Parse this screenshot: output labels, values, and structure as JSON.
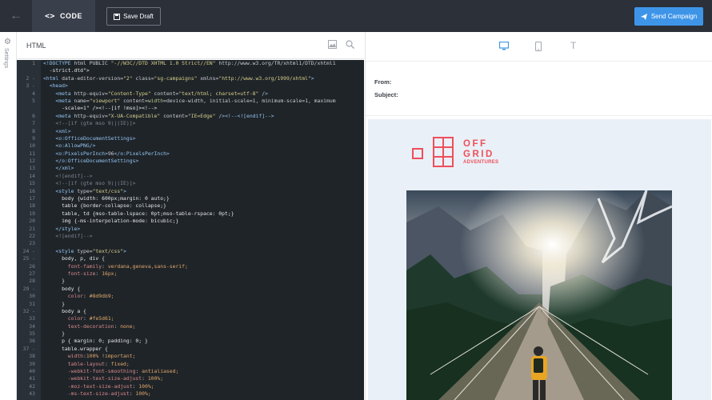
{
  "toolbar": {
    "back_icon": "arrow-left-icon",
    "code_tab_label": "CODE",
    "save_draft_label": "Save Draft",
    "send_campaign_label": "Send Campaign"
  },
  "rail": {
    "label": "Settings"
  },
  "editor": {
    "title": "HTML",
    "lines": [
      {
        "n": "1",
        "t": "<!DOCTYPE html PUBLIC \"-//W3C//DTD XHTML 1.0 Strict//EN\" \"http://www.w3.org/TR/xhtml1/DTD/xhtml1"
      },
      {
        "n": "",
        "t": "  -strict.dtd\">"
      },
      {
        "n": "2 -",
        "t": "<html data-editor-version=\"2\" class=\"sg-campaigns\" xmlns=\"http://www.w3.org/1999/xhtml\">"
      },
      {
        "n": "3 -",
        "t": "  <head>"
      },
      {
        "n": "4",
        "t": "    <meta http-equiv=\"Content-Type\" content=\"text/html; charset=utf-8\" />"
      },
      {
        "n": "5",
        "t": "    <meta name=\"viewport\" content=\"width=device-width, initial-scale=1, minimum-scale=1, maximum"
      },
      {
        "n": "",
        "t": "      -scale=1\" /><!--[if !mso]><!-->"
      },
      {
        "n": "6",
        "t": "    <meta http-equiv=\"X-UA-Compatible\" content=\"IE=Edge\" /><!--<![endif]-->"
      },
      {
        "n": "7",
        "t": "    <!--[if (gte mso 9)|(IE)]>"
      },
      {
        "n": "8",
        "t": "    <xml>"
      },
      {
        "n": "9",
        "t": "    <o:OfficeDocumentSettings>"
      },
      {
        "n": "10",
        "t": "    <o:AllowPNG/>"
      },
      {
        "n": "11",
        "t": "    <o:PixelsPerInch>96</o:PixelsPerInch>"
      },
      {
        "n": "12",
        "t": "    </o:OfficeDocumentSettings>"
      },
      {
        "n": "13",
        "t": "    </xml>"
      },
      {
        "n": "14",
        "t": "    <![endif]-->"
      },
      {
        "n": "15",
        "t": "    <!--[if (gte mso 9)|(IE)]>"
      },
      {
        "n": "16",
        "t": "    <style type=\"text/css\">"
      },
      {
        "n": "17",
        "t": "      body {width: 600px;margin: 0 auto;}"
      },
      {
        "n": "18",
        "t": "      table {border-collapse: collapse;}"
      },
      {
        "n": "19",
        "t": "      table, td {mso-table-lspace: 0pt;mso-table-rspace: 0pt;}"
      },
      {
        "n": "20",
        "t": "      img {-ms-interpolation-mode: bicubic;}"
      },
      {
        "n": "21",
        "t": "    </style>"
      },
      {
        "n": "22",
        "t": "    <![endif]-->"
      },
      {
        "n": "23",
        "t": ""
      },
      {
        "n": "24 -",
        "t": "    <style type=\"text/css\">"
      },
      {
        "n": "25 -",
        "t": "      body, p, div {"
      },
      {
        "n": "26",
        "t": "        font-family: verdana,geneva,sans-serif;"
      },
      {
        "n": "27",
        "t": "        font-size: 16px;"
      },
      {
        "n": "28",
        "t": "      }"
      },
      {
        "n": "29 -",
        "t": "      body {"
      },
      {
        "n": "30",
        "t": "        color: #8d9db9;"
      },
      {
        "n": "31",
        "t": "      }"
      },
      {
        "n": "32 -",
        "t": "      body a {"
      },
      {
        "n": "33",
        "t": "        color: #fe5d61;"
      },
      {
        "n": "34",
        "t": "        text-decoration: none;"
      },
      {
        "n": "35",
        "t": "      }"
      },
      {
        "n": "36",
        "t": "      p { margin: 0; padding: 0; }"
      },
      {
        "n": "37 -",
        "t": "      table.wrapper {"
      },
      {
        "n": "38",
        "t": "        width:100% !important;"
      },
      {
        "n": "39",
        "t": "        table-layout: fixed;"
      },
      {
        "n": "40",
        "t": "        -webkit-font-smoothing: antialiased;"
      },
      {
        "n": "41",
        "t": "        -webkit-text-size-adjust: 100%;"
      },
      {
        "n": "42",
        "t": "        -moz-text-size-adjust: 100%;"
      },
      {
        "n": "43",
        "t": "        -ms-text-size-adjust: 100%;"
      }
    ]
  },
  "preview": {
    "from_label": "From:",
    "subject_label": "Subject:",
    "logo": {
      "line1": "OFF",
      "line2": "GRID",
      "tagline": "ADVENTURES"
    }
  },
  "colors": {
    "topbar": "#2b3039",
    "accent": "#3e95e8",
    "logo": "#ef4f5a",
    "code_bg": "#1f2429",
    "email_bg": "#e9f0f7"
  }
}
